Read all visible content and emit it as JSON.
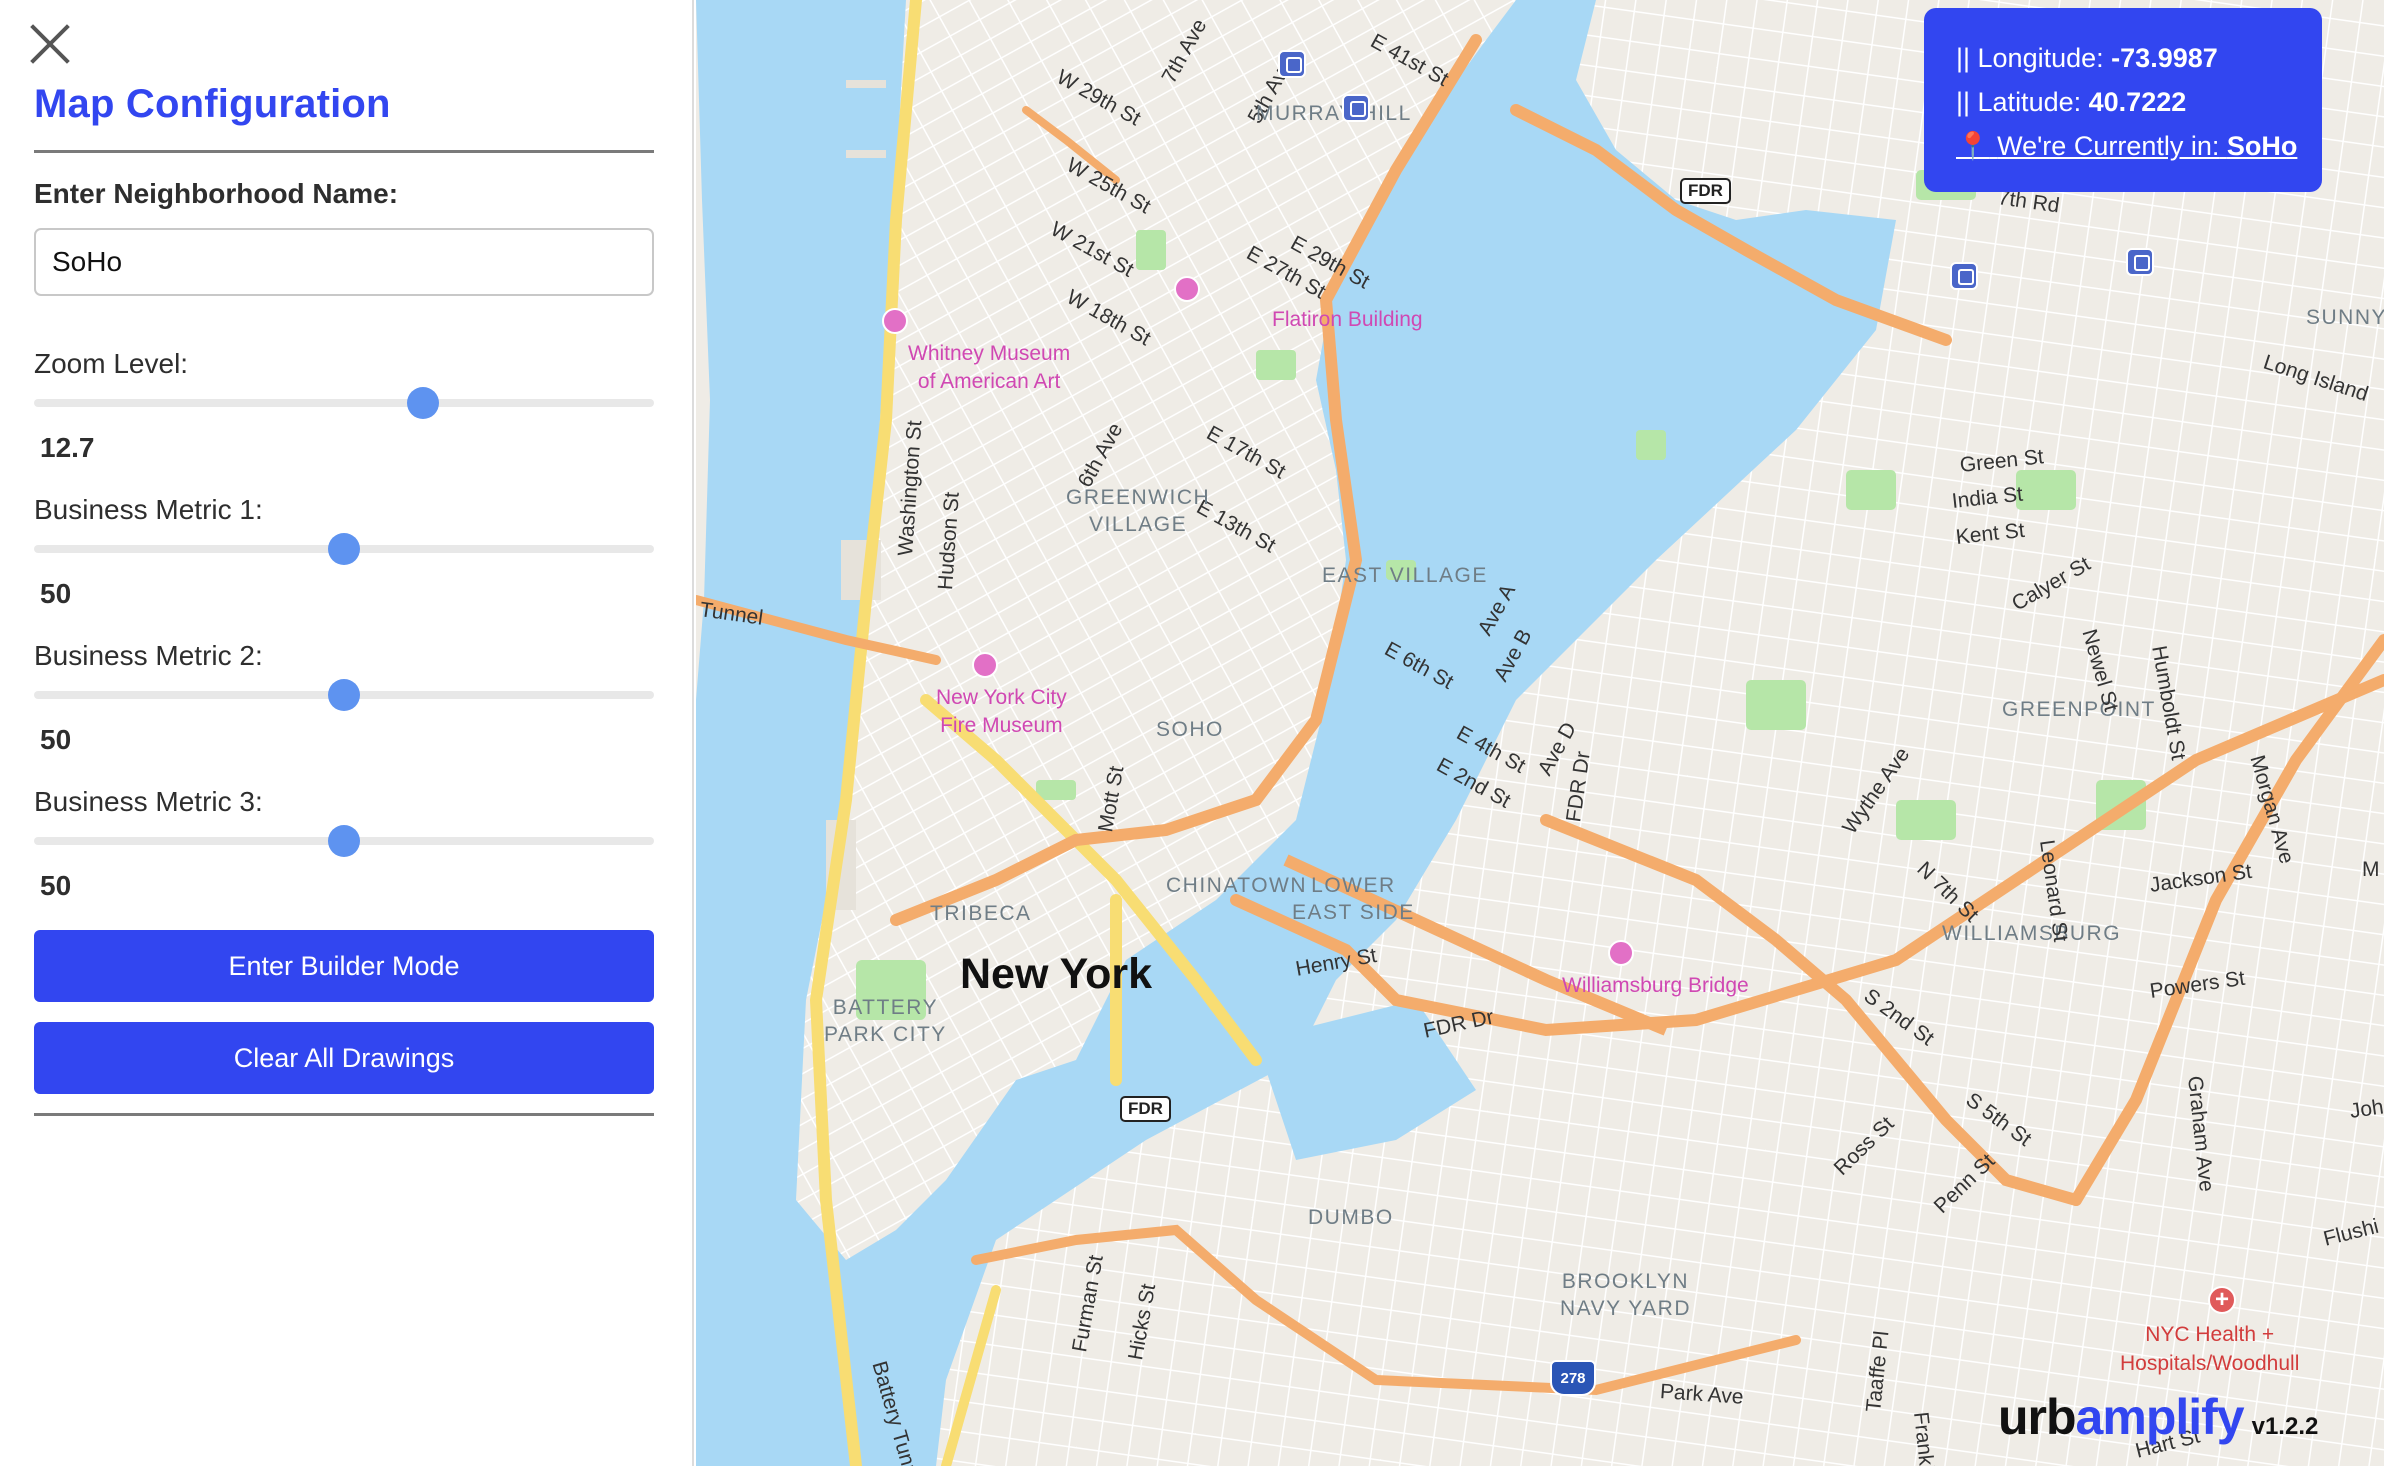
{
  "panel": {
    "title": "Map Configuration",
    "neighborhood_label": "Enter Neighborhood Name:",
    "neighborhood_value": "SoHo",
    "sliders": [
      {
        "label": "Zoom Level:",
        "value": "12.7",
        "fraction": 0.627
      },
      {
        "label": "Business Metric 1:",
        "value": "50",
        "fraction": 0.5
      },
      {
        "label": "Business Metric 2:",
        "value": "50",
        "fraction": 0.5
      },
      {
        "label": "Business Metric 3:",
        "value": "50",
        "fraction": 0.5
      }
    ],
    "builder_button": "Enter Builder Mode",
    "clear_button": "Clear All Drawings"
  },
  "info": {
    "longitude_label": "|| Longitude:",
    "longitude_value": "-73.9987",
    "latitude_label": "|| Latitude:",
    "latitude_value": "40.7222",
    "location_icon": "📍",
    "location_label": "We're Currently in:",
    "location_value": "SoHo"
  },
  "brand": {
    "urb": "urb",
    "amplify": "amplify",
    "version": "v1.2.2"
  },
  "colors": {
    "accent": "#3246f0",
    "water": "#a8d8f5",
    "highway": "#f4ac6c",
    "primary_road": "#f8dd73",
    "park": "#b6e6a8",
    "poi": "#d048b3"
  },
  "map": {
    "labels": {
      "w29": "W 29th St",
      "w25": "W 25th St",
      "w21": "W 21st St",
      "w18": "W 18th St",
      "seventh_ave": "7th Ave",
      "fifth_ave": "5th Ave",
      "sixth_ave": "6th Ave",
      "e41": "E 41st St",
      "murray_hill": "MURRAY HILL",
      "e29": "E 29th St",
      "e27": "E 27th St",
      "flatiron": "Flatiron Building",
      "whitney": "Whitney Museum\nof American Art",
      "e17": "E 17th St",
      "e13": "E 13th St",
      "greenwich": "GREENWICH\nVILLAGE",
      "east_village": "EAST VILLAGE",
      "e6": "E 6th St",
      "ave_a": "Ave A",
      "ave_b": "Ave B",
      "e4": "E 4th St",
      "e2": "E 2nd St",
      "ave_d": "Ave D",
      "fdr_dr_vert": "FDR Dr",
      "washington": "Washington St",
      "hudson": "Hudson St",
      "tunnel": "Tunnel",
      "firemuseum": "New York City\nFire Museum",
      "soho": "SOHO",
      "mott": "Mott St",
      "chinatown": "CHINATOWN",
      "les": "LOWER\nEAST SIDE",
      "tribeca": "TRIBECA",
      "henry": "Henry St",
      "new_york": "New York",
      "battery_park": "BATTERY\nPARK CITY",
      "fdr_dr": "FDR Dr",
      "williamsburg_bridge": "Williamsburg Bridge",
      "dumbo": "DUMBO",
      "brooklyn_navy": "BROOKLYN\nNAVY YARD",
      "furman": "Furman St",
      "hicks": "Hicks St",
      "battery_tunnel": "Battery Tunn",
      "park_ave": "Park Ave",
      "nyc_health": "NYC Health +\nHospitals/Woodhull",
      "taaffe": "Taaffe Pl",
      "franklin": "Franklin Av",
      "hart": "Hart St",
      "flushing": "Flushi",
      "penn": "Penn St",
      "ross": "Ross St",
      "s5": "S 5th St",
      "s2": "S 2nd St",
      "williamsburg": "WILLIAMSBURG",
      "powers": "Powers St",
      "graham": "Graham Ave",
      "john": "Joh",
      "jackson": "Jackson St",
      "n7": "N 7th St",
      "wythe": "Wythe Ave",
      "leonard": "Leonard St",
      "greenpoint": "GREENPOINT",
      "morgan": "Morgan Ave",
      "m_edge": "M",
      "green": "Green St",
      "india": "India St",
      "kent": "Kent St",
      "calyer": "Calyer St",
      "newel": "Newel St",
      "humboldt": "Humboldt St",
      "sunnys": "SUNNYS",
      "long_island": "Long Island",
      "rd": "7th Rd"
    },
    "shields": {
      "fdr1": "FDR",
      "fdr2": "FDR",
      "i278": "278"
    }
  }
}
